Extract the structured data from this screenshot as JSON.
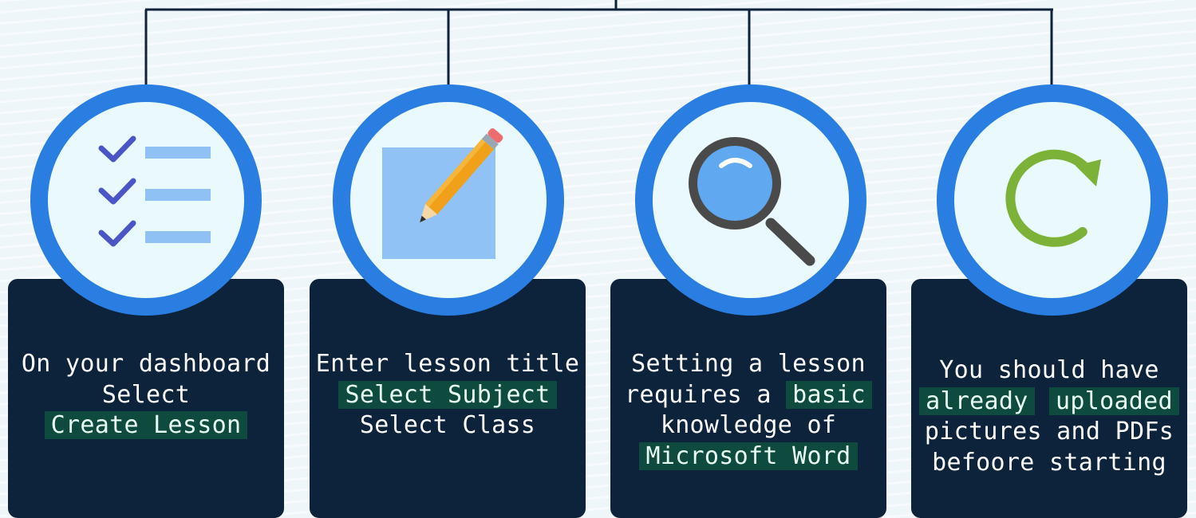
{
  "steps": [
    {
      "icon": "checklist-icon",
      "lines": [
        {
          "segments": [
            {
              "text": "On your dashboard",
              "highlight": false
            }
          ]
        },
        {
          "segments": [
            {
              "text": "Select",
              "highlight": false
            }
          ]
        },
        {
          "segments": [
            {
              "text": "Create Lesson",
              "highlight": true
            }
          ]
        }
      ]
    },
    {
      "icon": "pencil-icon",
      "lines": [
        {
          "segments": [
            {
              "text": "Enter lesson title",
              "highlight": false
            }
          ]
        },
        {
          "segments": [
            {
              "text": "Select Subject",
              "highlight": true
            }
          ]
        },
        {
          "segments": [
            {
              "text": "Select Class",
              "highlight": false
            }
          ]
        }
      ]
    },
    {
      "icon": "magnifier-icon",
      "lines": [
        {
          "segments": [
            {
              "text": "Setting a lesson",
              "highlight": false
            }
          ]
        },
        {
          "segments": [
            {
              "text": "requires a ",
              "highlight": false
            },
            {
              "text": "basic",
              "highlight": true
            }
          ]
        },
        {
          "segments": [
            {
              "text": "knowledge of",
              "highlight": false
            }
          ]
        },
        {
          "segments": [
            {
              "text": "Microsoft Word",
              "highlight": true
            }
          ]
        }
      ]
    },
    {
      "icon": "refresh-icon",
      "lines": [
        {
          "segments": [
            {
              "text": "You should have",
              "highlight": false
            }
          ]
        },
        {
          "segments": [
            {
              "text": "already",
              "highlight": true
            },
            {
              "text": " ",
              "highlight": false
            },
            {
              "text": "uploaded",
              "highlight": true
            }
          ]
        },
        {
          "segments": [
            {
              "text": "pictures and PDFs",
              "highlight": false
            }
          ]
        },
        {
          "segments": [
            {
              "text": "befoore starting",
              "highlight": false
            }
          ]
        }
      ]
    }
  ],
  "colors": {
    "card_bg": "#0d223b",
    "ring": "#2a7ee1",
    "circle_fill": "#e9f9fd",
    "highlight_bg": "#0e4a3e",
    "connector": "#0d223b"
  }
}
